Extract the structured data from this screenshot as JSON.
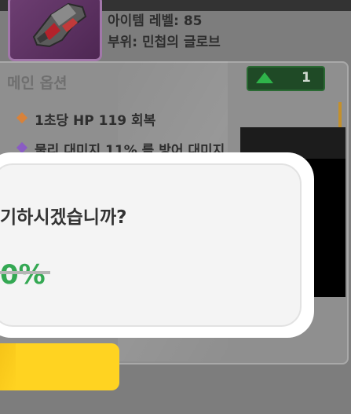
{
  "item": {
    "level_text": "아이템 레벨: 85",
    "part_text": "부위: 민첩의 글로브",
    "icon": "gauntlet-icon"
  },
  "main_option": {
    "title": "메인 옵션",
    "grade_count": "1",
    "options": [
      {
        "text": "1초당 HP 119 회복",
        "bullet_color": "#d8823a"
      },
      {
        "text": "물리 대미지 11% 를 방어 대미지",
        "bullet_color": "#8a5cc4"
      }
    ]
  },
  "dialog": {
    "question": "기하시겠습니까?",
    "chance": "0%"
  },
  "colors": {
    "accent_green": "#34a853",
    "button_yellow": "#ffd321",
    "icon_frame": "#a277aa"
  }
}
